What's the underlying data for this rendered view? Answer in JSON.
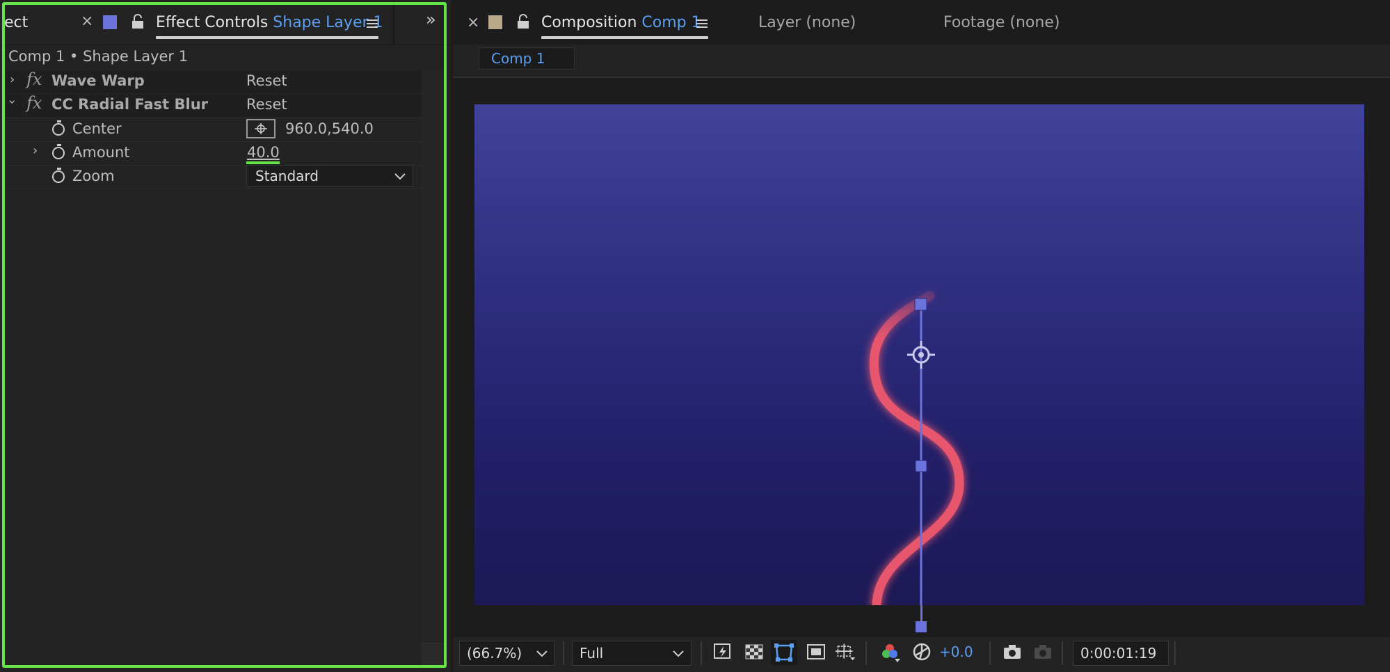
{
  "effect_controls_panel": {
    "prev_tab_label": "ect",
    "tab_title": "Effect Controls",
    "tab_layer": "Shape Layer 1",
    "breadcrumb": "Comp 1 • Shape Layer 1",
    "effects": [
      {
        "name": "Wave Warp",
        "reset_label": "Reset",
        "expanded": false
      },
      {
        "name": "CC Radial Fast Blur",
        "reset_label": "Reset",
        "expanded": true
      }
    ],
    "properties": {
      "center": {
        "label": "Center",
        "value": "960.0,540.0"
      },
      "amount": {
        "label": "Amount",
        "value": "40.0"
      },
      "zoom": {
        "label": "Zoom",
        "value": "Standard"
      }
    },
    "label_color": "#6b73d9"
  },
  "composition_panel": {
    "tab_title": "Composition",
    "tab_comp": "Comp 1",
    "layer_tab": "Layer (none)",
    "footage_tab": "Footage (none)",
    "comp_button": "Comp 1",
    "label_color": "#b9a88a"
  },
  "viewer_toolbar": {
    "zoom": "(66.7%)",
    "resolution": "Full",
    "exposure": "+0.0",
    "timecode": "0:00:01:19"
  },
  "colors": {
    "accent_blue": "#5c9ff0",
    "highlight_green": "#67e34a",
    "stroke_red": "#e8566e"
  }
}
